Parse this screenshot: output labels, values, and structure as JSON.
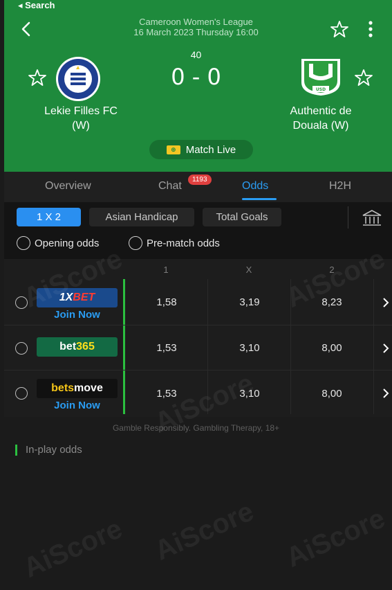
{
  "status_bar": {
    "back_label": "◂ Search"
  },
  "match": {
    "league": "Cameroon Women's League",
    "datetime": "16 March 2023 Thursday 16:00",
    "minute": "40",
    "score": "0 - 0",
    "home_team": "Lekie Filles FC",
    "home_suffix": "(W)",
    "away_team": "Authentic de",
    "away_team_line2": "Douala (W)",
    "live_label": "Match Live",
    "away_logo_text": "U.S.D",
    "home_logo_text": "CLUB SPORT FC DE LA LEKIE"
  },
  "tabs": [
    {
      "label": "Overview"
    },
    {
      "label": "Chat",
      "badge": "1193"
    },
    {
      "label": "Odds"
    },
    {
      "label": "H2H"
    }
  ],
  "filters": {
    "chips": [
      {
        "label": "1 X 2",
        "active": true
      },
      {
        "label": "Asian Handicap",
        "active": false
      },
      {
        "label": "Total Goals",
        "active": false
      }
    ],
    "radios": [
      "Opening odds",
      "Pre-match odds"
    ]
  },
  "table": {
    "columns": [
      "1",
      "X",
      "2"
    ],
    "rows": [
      {
        "bookmaker": "1XBET",
        "join": "Join Now",
        "odds": [
          "1,58",
          "3,19",
          "8,23"
        ]
      },
      {
        "bookmaker": "bet365",
        "join": "",
        "odds": [
          "1,53",
          "3,10",
          "8,00"
        ]
      },
      {
        "bookmaker": "betsmove",
        "join": "Join Now",
        "odds": [
          "1,53",
          "3,10",
          "8,00"
        ]
      }
    ]
  },
  "footer": {
    "gamble": "Gamble Responsibly. Gambling Therapy, 18+",
    "inplay": "In-play odds"
  },
  "watermark": "AiScore",
  "colors": {
    "header_green": "#1e8a3c",
    "accent_blue": "#2a9cf2",
    "badge_red": "#e0403f",
    "row_green": "#2bbf3f"
  }
}
